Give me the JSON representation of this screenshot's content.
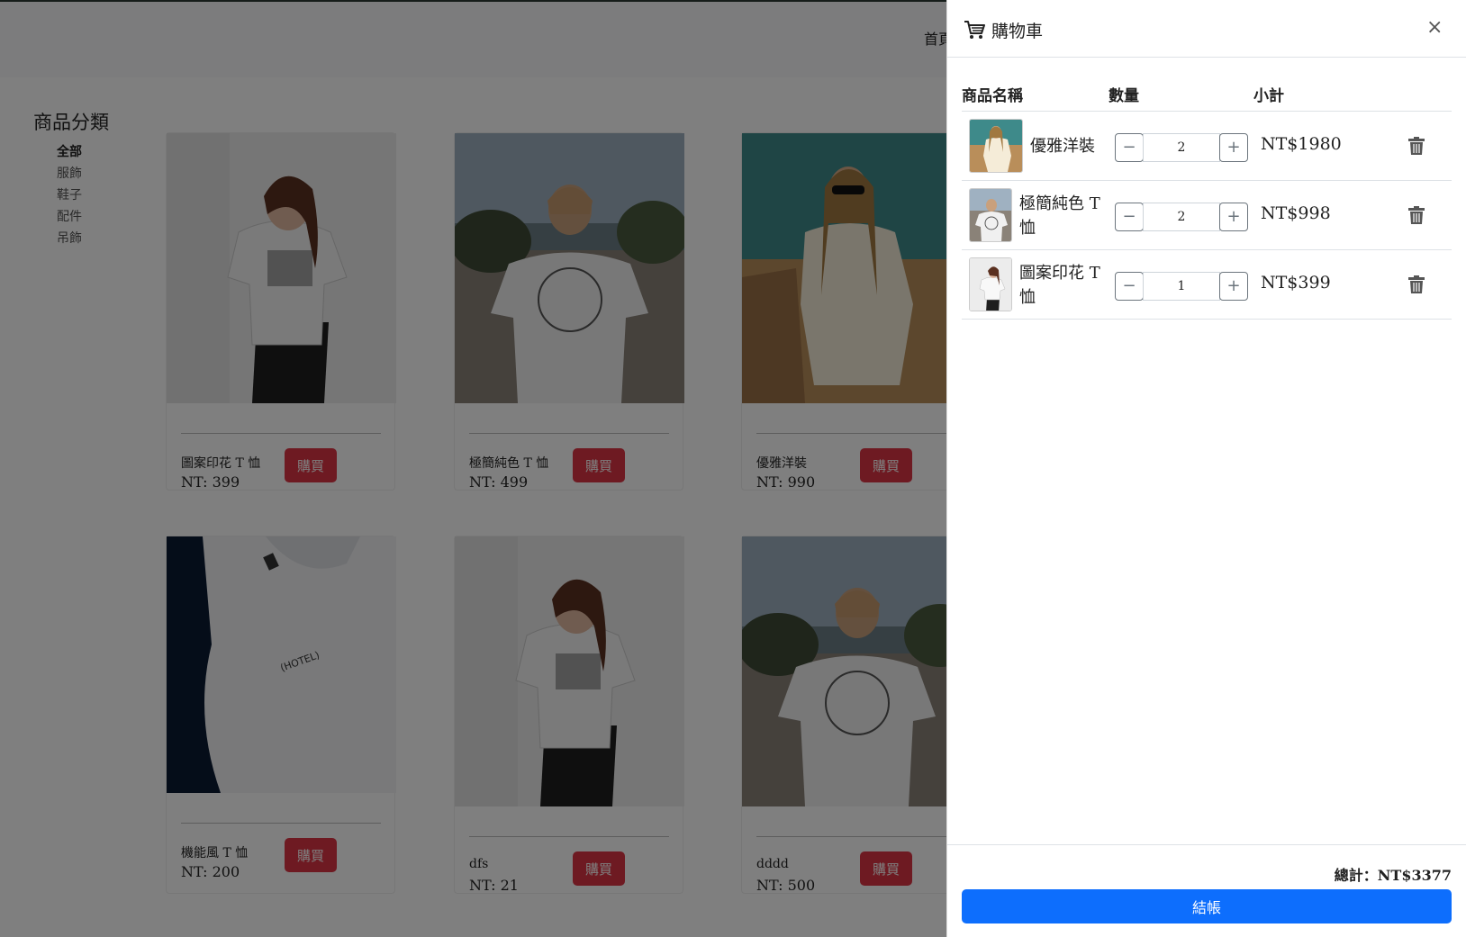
{
  "nav": {
    "home": "首頁"
  },
  "sidebar": {
    "title": "商品分類",
    "categories": [
      "全部",
      "服飾",
      "鞋子",
      "配件",
      "吊飾"
    ]
  },
  "products": [
    {
      "name": "圖案印花 T 恤",
      "price": "NT: 399",
      "buy": "購買"
    },
    {
      "name": "極簡純色 T 恤",
      "price": "NT: 499",
      "buy": "購買"
    },
    {
      "name": "優雅洋裝",
      "price": "NT: 990",
      "buy": "購買"
    },
    {
      "name": "機能風 T 恤",
      "price": "NT: 200",
      "buy": "購買"
    },
    {
      "name": "dfs",
      "price": "NT: 21",
      "buy": "購買"
    },
    {
      "name": "dddd",
      "price": "NT: 500",
      "buy": "購買"
    }
  ],
  "cart": {
    "title": "購物車",
    "close": "×",
    "headers": {
      "name": "商品名稱",
      "qty": "數量",
      "subtotal": "小計"
    },
    "items": [
      {
        "name": "優雅洋裝",
        "qty": "2",
        "subtotal": "NT$1980"
      },
      {
        "name": "極簡純色 T 恤",
        "qty": "2",
        "subtotal": "NT$998"
      },
      {
        "name": "圖案印花 T 恤",
        "qty": "1",
        "subtotal": "NT$399"
      }
    ],
    "minus": "−",
    "plus": "+",
    "total": "總計：NT$3377",
    "checkout": "結帳"
  }
}
